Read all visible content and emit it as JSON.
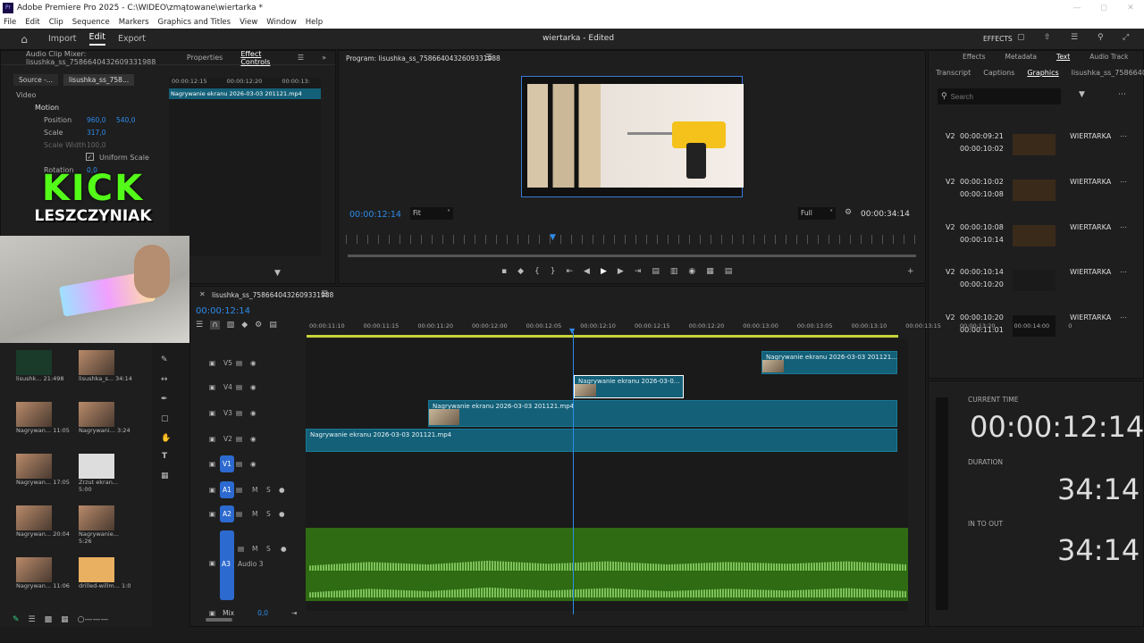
{
  "titlebar": {
    "title": "Adobe Premiere Pro 2025 - C:\\WIDEO\\zmątowane\\wiertarka *"
  },
  "menu": [
    "File",
    "Edit",
    "Clip",
    "Sequence",
    "Markers",
    "Graphics and Titles",
    "View",
    "Window",
    "Help"
  ],
  "header": {
    "workspaces": [
      "Import",
      "Edit",
      "Export"
    ],
    "project_title": "wiertarka - Edited",
    "effects_label": "EFFECTS"
  },
  "effect_panel": {
    "tabs": [
      "Audio Clip Mixer: lisushka_ss_7586640432609331988",
      "Properties",
      "Effect Controls"
    ],
    "source_tab": "Source -...",
    "seq_tab": "lisushka_ss_758...",
    "section_video": "Video",
    "motion": "Motion",
    "position_label": "Position",
    "position_x": "960,0",
    "position_y": "540,0",
    "scale_label": "Scale",
    "scale_value": "317,0",
    "scale_width_label": "Scale Width",
    "scale_width_value": "100,0",
    "uniform_scale": "Uniform Scale",
    "rotation_label": "Rotation",
    "rotation_value": "0,0",
    "ruler": [
      "00:00:12:15",
      "00:00:12:20",
      "00:00:13:"
    ],
    "clip_name": "Nagrywanie ekranu 2026-03-03 201121.mp4"
  },
  "overlay": {
    "line1": "KICK",
    "line2": "LESZCZYNIAK"
  },
  "program": {
    "tab": "Program: lisushka_ss_7586640432609331988",
    "timecode": "00:00:12:14",
    "fit": "Fit",
    "quality": "Full",
    "duration": "00:00:34:14"
  },
  "right_panel": {
    "top_tabs": [
      "Effects",
      "Metadata",
      "Text",
      "Audio Track"
    ],
    "sub_tabs": [
      "Transcript",
      "Captions",
      "Graphics",
      "lisushka_ss_7586640"
    ],
    "search_placeholder": "Search",
    "items": [
      {
        "track": "V2",
        "tin": "00:00:09:21",
        "tout": "00:00:10:02",
        "name": "WIERTARKA"
      },
      {
        "track": "V2",
        "tin": "00:00:10:02",
        "tout": "00:00:10:08",
        "name": "WIERTARKA"
      },
      {
        "track": "V2",
        "tin": "00:00:10:08",
        "tout": "00:00:10:14",
        "name": "WIERTARKA"
      },
      {
        "track": "V2",
        "tin": "00:00:10:14",
        "tout": "00:00:10:20",
        "name": "WIERTARKA"
      },
      {
        "track": "V2",
        "tin": "00:00:10:20",
        "tout": "00:00:11:01",
        "name": "WIERTARKA"
      }
    ],
    "current_time_label": "CURRENT TIME",
    "current_time": "00:00:12:14",
    "duration_label": "DURATION",
    "duration": "34:14",
    "in_out_label": "IN TO OUT",
    "in_out": "34:14"
  },
  "timeline": {
    "tab": "lisushka_ss_7586640432609331988",
    "timecode": "00:00:12:14",
    "ruler": [
      "00:00:11:10",
      "00:00:11:15",
      "00:00:11:20",
      "00:00:12:00",
      "00:00:12:05",
      "00:00:12:10",
      "00:00:12:15",
      "00:00:12:20",
      "00:00:13:00",
      "00:00:13:05",
      "00:00:13:10",
      "00:00:13:15",
      "00:00:13:20",
      "00:00:14:00",
      "0"
    ],
    "tracks_video": [
      "V5",
      "V4",
      "V3",
      "V2",
      "V1"
    ],
    "tracks_audio": [
      "A1",
      "A2",
      "A3"
    ],
    "audio3_name": "Audio 3",
    "mix_label": "Mix",
    "mix_value": "0,0",
    "clips": {
      "v5": "Nagrywanie ekranu 2026-03-03 201121...",
      "v4": "Nagrywanie ekranu 2026-03-0...",
      "v3": "Nagrywanie ekranu 2026-03-03 201121.mp4",
      "v2": "Nagrywanie ekranu 2026-03-03 201121.mp4"
    },
    "m_label": "M",
    "s_label": "S"
  },
  "bin": [
    {
      "name": "lisushk...",
      "dur": "21:498"
    },
    {
      "name": "lisushka_s...",
      "dur": "34:14"
    },
    {
      "name": "Nagrywan...",
      "dur": "11:05"
    },
    {
      "name": "Nagrywani...",
      "dur": "3:24"
    },
    {
      "name": "Nagrywan...",
      "dur": "17:05"
    },
    {
      "name": "Zrzut ekran...",
      "dur": "5:00"
    },
    {
      "name": "Nagrywan...",
      "dur": "20:04"
    },
    {
      "name": "Nagrywanie...",
      "dur": "5:26"
    },
    {
      "name": "Nagrywan...",
      "dur": "11:06"
    },
    {
      "name": "drilled-willm...",
      "dur": "1:0"
    }
  ],
  "colors": {
    "accent": "#2d8ceb",
    "clip": "#136078",
    "audio": "#2e6b12"
  }
}
